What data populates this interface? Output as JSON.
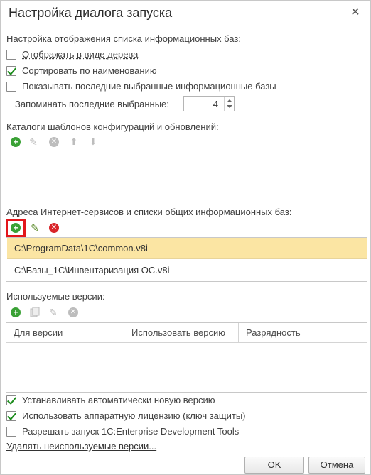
{
  "window": {
    "title": "Настройка диалога запуска",
    "close_glyph": "✕"
  },
  "infobases": {
    "heading": "Настройка отображения списка информационных баз:",
    "show_tree": {
      "label": "Отображать в виде дерева",
      "checked": false
    },
    "sort_by_name": {
      "label": "Сортировать по наименованию",
      "checked": true
    },
    "show_recent": {
      "label": "Показывать последние выбранные информационные базы",
      "checked": false
    },
    "remember_label": "Запоминать последние выбранные:",
    "remember_value": "4"
  },
  "templates": {
    "heading": "Каталоги шаблонов конфигураций и обновлений:",
    "toolbar": [
      "add-icon",
      "edit-icon",
      "delete-icon",
      "move-up-icon",
      "move-down-icon"
    ],
    "items": []
  },
  "services": {
    "heading": "Адреса Интернет-сервисов и списки общих информационных баз:",
    "toolbar": [
      "add-icon",
      "edit-icon",
      "delete-icon"
    ],
    "items": [
      {
        "path": "C:\\ProgramData\\1C\\common.v8i",
        "selected": true
      },
      {
        "path": "C:\\Базы_1С\\Инвентаризация ОС.v8i",
        "selected": false
      }
    ],
    "highlight_color": "#e3161b",
    "selection_color": "#fbe5a3"
  },
  "versions": {
    "heading": "Используемые версии:",
    "toolbar": [
      "add-icon",
      "copy-icon",
      "edit-icon",
      "delete-icon"
    ],
    "columns": [
      "Для версии",
      "Использовать версию",
      "Разрядность"
    ],
    "rows": []
  },
  "options": {
    "auto_install": {
      "label": "Устанавливать автоматически новую версию",
      "checked": true
    },
    "hardware_license": {
      "label": "Использовать аппаратную лицензию (ключ защиты)",
      "checked": true
    },
    "edt": {
      "label": "Разрешать запуск 1C:Enterprise Development Tools",
      "checked": false
    }
  },
  "remove_unused_link": "Удалять неиспользуемые версии...",
  "buttons": {
    "ok": "OK",
    "cancel": "Отмена"
  }
}
